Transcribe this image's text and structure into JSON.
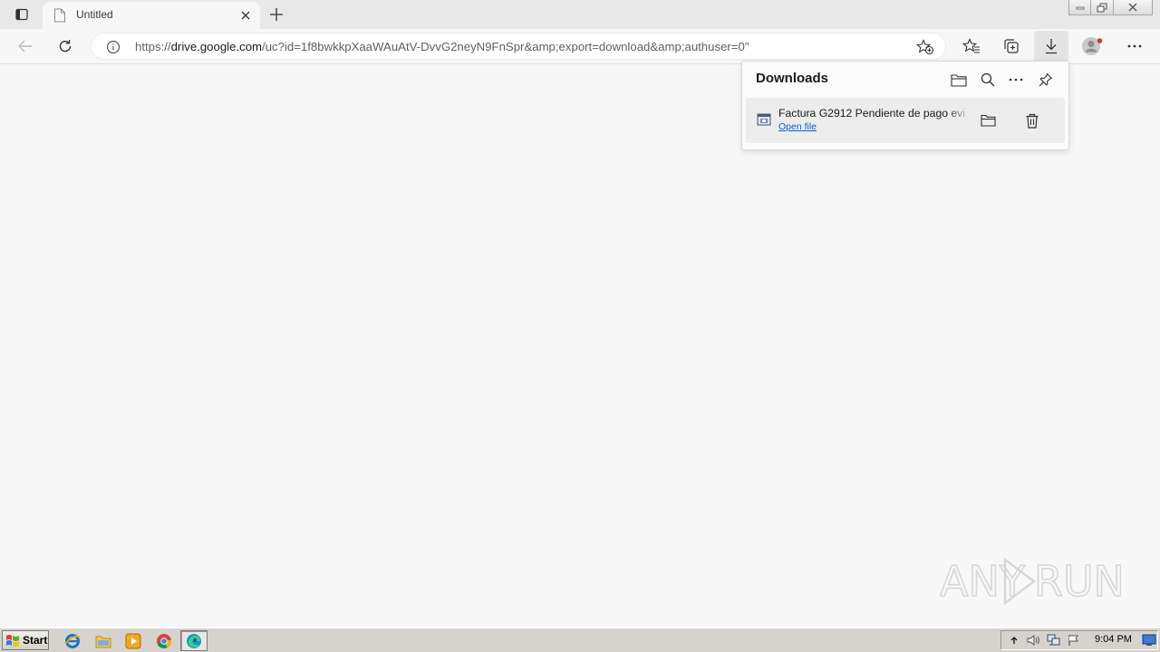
{
  "browser": {
    "tab": {
      "title": "Untitled"
    },
    "address": {
      "scheme": "https://",
      "host": "drive.google.com",
      "path": "/uc?id=1f8bwkkpXaaWAuAtV-DvvG2neyN9FnSpr&amp;export=download&amp;authuser=0\""
    },
    "toolbar_icons": [
      "back-icon",
      "refresh-icon",
      "info-icon",
      "add-favorite-icon",
      "favorites-icon",
      "collections-icon",
      "downloads-icon",
      "profile-icon",
      "more-icon"
    ]
  },
  "downloads_panel": {
    "title": "Downloads",
    "header_icons": [
      "folder-icon",
      "search-icon",
      "more-icon",
      "pin-icon"
    ],
    "items": [
      {
        "file_name": "Factura G2912 Pendiente de pago evi",
        "action_label": "Open file"
      }
    ]
  },
  "watermark": {
    "text": "ANY RUN"
  },
  "taskbar": {
    "start_label": "Start",
    "quick_launch": [
      "ie-icon",
      "explorer-icon",
      "media-player-icon",
      "chrome-icon",
      "edge-icon"
    ],
    "clock": "9:04 PM"
  },
  "colors": {
    "accent": "#0563c1",
    "page_bg": "#f7f7f7",
    "taskbar": "#d6d3ce",
    "profile_badge": "#d13438"
  }
}
